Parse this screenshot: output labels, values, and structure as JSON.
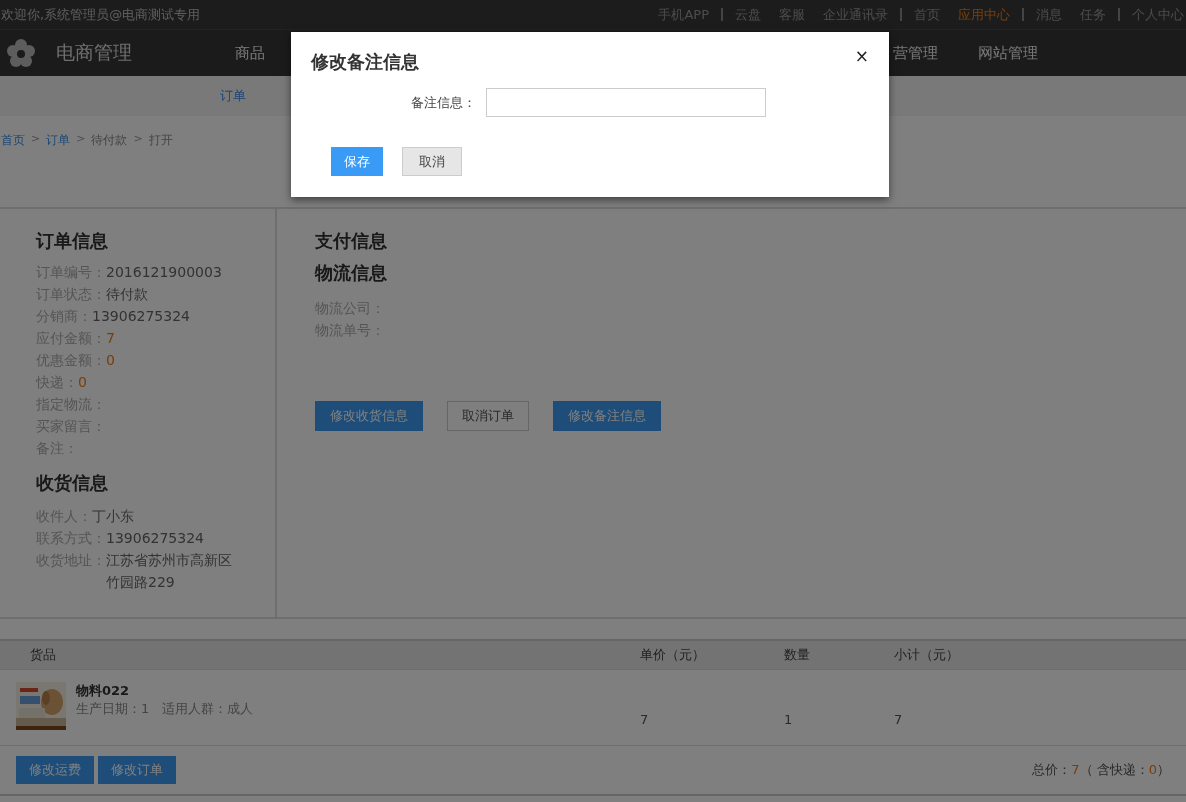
{
  "top_bar": {
    "welcome": "欢迎你,系统管理员@电商测试专用",
    "link_groups": [
      [
        {
          "label": "手机APP",
          "selected": false
        }
      ],
      [
        {
          "label": "云盘",
          "selected": false
        },
        {
          "label": "客服",
          "selected": false
        },
        {
          "label": "企业通讯录",
          "selected": false
        }
      ],
      [
        {
          "label": "首页",
          "selected": false
        },
        {
          "label": "应用中心",
          "selected": true
        }
      ],
      [
        {
          "label": "消息",
          "selected": false
        },
        {
          "label": "任务",
          "selected": false
        }
      ],
      [
        {
          "label": "个人中心",
          "selected": false
        }
      ]
    ]
  },
  "header": {
    "app_name": "电商管理",
    "nav_left": [
      "商品"
    ],
    "nav_right": [
      "营管理",
      "网站管理"
    ]
  },
  "sub_nav": [
    {
      "label": "订单",
      "selected": true
    }
  ],
  "breadcrumb": {
    "separator": ">",
    "items": [
      {
        "label": "首页",
        "link": true
      },
      {
        "label": "订单",
        "link": true
      },
      {
        "label": "待付款",
        "link": false
      },
      {
        "label": "打开",
        "link": false
      }
    ]
  },
  "order_info": {
    "title": "订单信息",
    "fields": [
      {
        "label": "订单编号：",
        "value": "2016121900003",
        "highlight": false
      },
      {
        "label": "订单状态：",
        "value": "待付款",
        "highlight": false
      },
      {
        "label": "分销商：",
        "value": "13906275324",
        "highlight": false
      },
      {
        "label": "应付金额：",
        "value": "7",
        "highlight": true
      },
      {
        "label": "优惠金额：",
        "value": "0",
        "highlight": true
      },
      {
        "label": "快递：",
        "value": "0",
        "highlight": true
      },
      {
        "label": "指定物流："
      },
      {
        "label": "买家留言："
      },
      {
        "label": "备注："
      }
    ]
  },
  "shipping_info": {
    "title": "收货信息",
    "fields": [
      {
        "label": "收件人：",
        "value": "丁小东",
        "highlight": false
      },
      {
        "label": "联系方式：",
        "value": "13906275324",
        "highlight": false
      },
      {
        "label": "收货地址：",
        "value": "江苏省苏州市高新区竹园路229",
        "highlight": false
      }
    ]
  },
  "payment_info": {
    "title": "支付信息"
  },
  "logistics_info": {
    "title": "物流信息",
    "fields": [
      {
        "label": "物流公司："
      },
      {
        "label": "物流单号："
      }
    ]
  },
  "actions": [
    {
      "label": "修改收货信息",
      "kind": "primary"
    },
    {
      "label": "取消订单",
      "kind": "default"
    },
    {
      "label": "修改备注信息",
      "kind": "primary"
    }
  ],
  "table": {
    "columns": [
      "货品",
      "单价（元）",
      "数量",
      "小计（元）"
    ],
    "rows": [
      {
        "name": "物料022",
        "attrs": "生产日期：1   适用人群：成人",
        "price": "7",
        "qty": "1",
        "subtotal": "7"
      }
    ]
  },
  "footer": {
    "buttons": [
      "修改运费",
      "修改订单"
    ],
    "total_label": "总价：",
    "total": "7",
    "shipping_prefix": "（ 含快递：",
    "shipping": "0",
    "shipping_suffix": "）"
  },
  "dialog": {
    "title": "修改备注信息",
    "close": "×",
    "field_label": "备注信息：",
    "buttons": [
      {
        "label": "保存",
        "kind": "primary"
      },
      {
        "label": "取消",
        "kind": "default"
      }
    ]
  }
}
